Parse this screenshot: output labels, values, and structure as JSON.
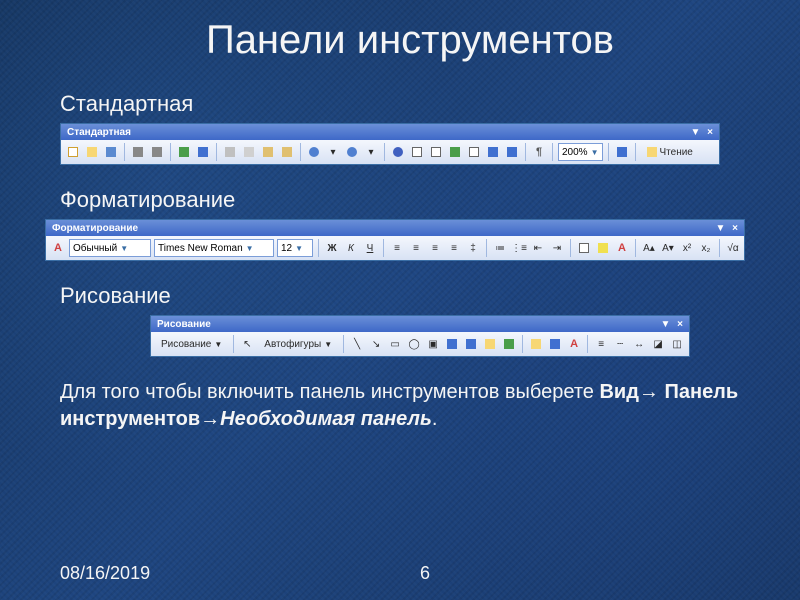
{
  "title": "Панели инструментов",
  "sections": {
    "standard": "Стандартная",
    "formatting": "Форматирование",
    "drawing": "Рисование"
  },
  "toolbar_titles": {
    "standard": "Стандартная",
    "formatting": "Форматирование",
    "drawing": "Рисование"
  },
  "standard": {
    "zoom": "200%",
    "reading_btn": "Чтение"
  },
  "formatting": {
    "style": "Обычный",
    "font": "Times New Roman",
    "size": "12",
    "bold": "Ж",
    "italic": "К",
    "underline": "Ч"
  },
  "drawing": {
    "menu": "Рисование",
    "autoshapes": "Автофигуры"
  },
  "instruction": {
    "prefix": "Для того чтобы включить панель инструментов выберете ",
    "b1": "Вид",
    "arrow": "→",
    "b2": "Панель инструментов",
    "i1": "Необходимая панель",
    "period": "."
  },
  "footer_date": "08/16/2019",
  "page_number": "6"
}
